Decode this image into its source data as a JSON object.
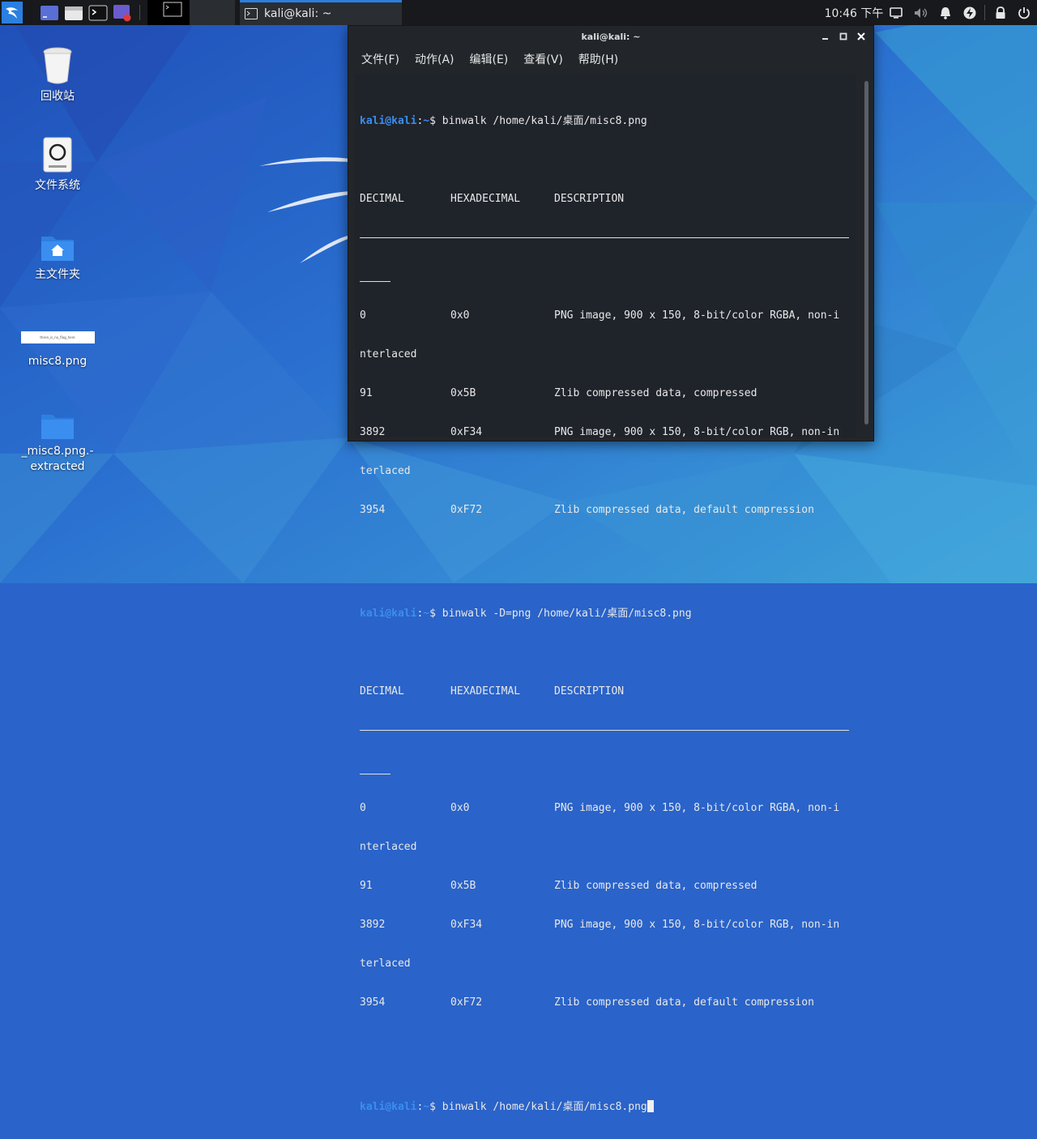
{
  "taskbar": {
    "task_label": "kali@kali: ~",
    "clock": "10:46 下午"
  },
  "desktop": {
    "icons": [
      {
        "label": "回收站"
      },
      {
        "label": "文件系统"
      },
      {
        "label": "主文件夹"
      },
      {
        "label": "misc8.png",
        "thumb_text": "there_is_no_flag_here"
      },
      {
        "label": "_misc8.png.-\nextracted"
      }
    ]
  },
  "window": {
    "title": "kali@kali: ~",
    "menu": [
      "文件(F)",
      "动作(A)",
      "编辑(E)",
      "查看(V)",
      "帮助(H)"
    ]
  },
  "terminal": {
    "user_host": "kali@kali",
    "path": "~",
    "prompt_sym": "$",
    "commands": [
      "binwalk /home/kali/桌面/misc8.png",
      "binwalk -D=png /home/kali/桌面/misc8.png",
      "binwalk /home/kali/桌面/misc8.png"
    ],
    "header": {
      "decimal": "DECIMAL",
      "hex": "HEXADECIMAL",
      "desc": "DESCRIPTION"
    },
    "rows": [
      {
        "decimal": "0",
        "hex": "0x0",
        "desc": "PNG image, 900 x 150, 8-bit/color RGBA, non-i",
        "wrap": "nterlaced"
      },
      {
        "decimal": "91",
        "hex": "0x5B",
        "desc": "Zlib compressed data, compressed",
        "wrap": ""
      },
      {
        "decimal": "3892",
        "hex": "0xF34",
        "desc": "PNG image, 900 x 150, 8-bit/color RGB, non-in",
        "wrap": "terlaced"
      },
      {
        "decimal": "3954",
        "hex": "0xF72",
        "desc": "Zlib compressed data, default compression",
        "wrap": ""
      }
    ]
  },
  "colors": {
    "accent": "#2b7fe0",
    "prompt": "#3a8ef0",
    "terminal_bg": "#1f232a"
  }
}
